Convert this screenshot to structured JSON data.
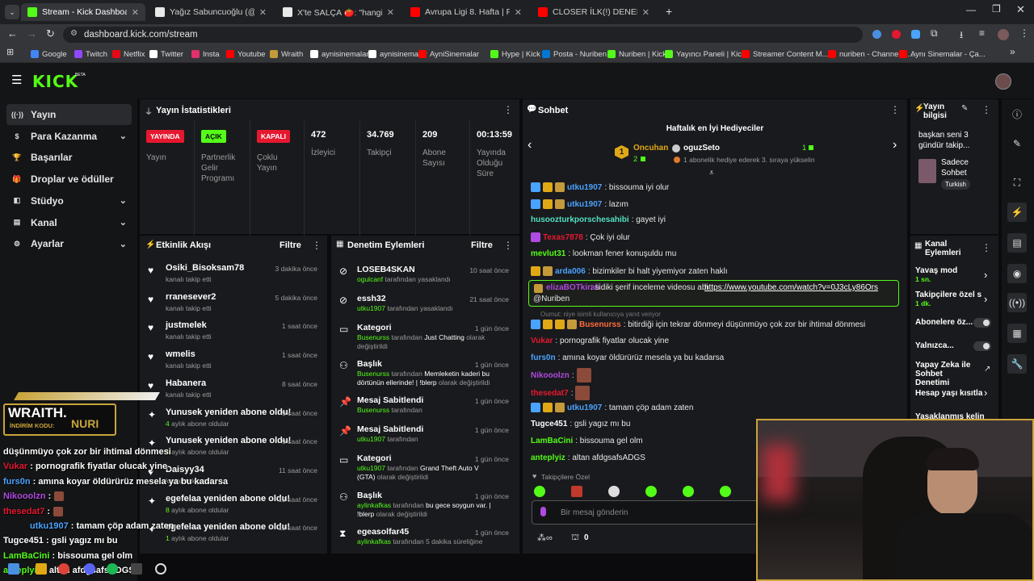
{
  "browser": {
    "tabs": [
      {
        "title": "Stream - Kick Dashboard",
        "color": "#53fc18"
      },
      {
        "title": "Yağız Sabuncuoğlu (@yagosabu",
        "color": "#e8e8e8"
      },
      {
        "title": "X'te SALÇA 🍅: \"hangimiz şamp",
        "color": "#e8e8e8"
      },
      {
        "title": "Avrupa Ligi 8. Hafta | FCSB - Fe",
        "color": "#ff0000"
      },
      {
        "title": "CLOSER İLK(!) DENEMEDE BAŞA",
        "color": "#ff0000"
      }
    ],
    "url": "dashboard.kick.com/stream",
    "bookmarks": [
      "Google",
      "Twitch",
      "Netflix",
      "Twitter",
      "Insta",
      "Youtube",
      "Wraith",
      "aynisinemalar",
      "aynisinemalar",
      "AyniSinemalar",
      "Hype | Kick",
      "Posta - Nuriben",
      "Nuriben | Kick",
      "Yayıncı Paneli | Kick",
      "Streamer Content M...",
      "nuriben - Channel S...",
      "Aynı Sinemalar - Ça..."
    ],
    "bookmark_colors": [
      "#4285f4",
      "#9146ff",
      "#e50914",
      "#ffffff",
      "#e1306c",
      "#ff0000",
      "#c49a3a",
      "#ffffff",
      "#ffffff",
      "#ff0000",
      "#53fc18",
      "#0078d4",
      "#53fc18",
      "#53fc18",
      "#ff0000",
      "#ff0000",
      "#ff0000"
    ]
  },
  "header": {
    "logo": "KICK",
    "beta": "BETA"
  },
  "sidebar": {
    "items": [
      {
        "label": "Yayın",
        "icon": "broadcast-icon"
      },
      {
        "label": "Para Kazanma",
        "icon": "money-icon"
      },
      {
        "label": "Başarılar",
        "icon": "trophy-icon"
      },
      {
        "label": "Droplar ve ödüller",
        "icon": "gift-icon"
      },
      {
        "label": "Stüdyo",
        "icon": "studio-icon"
      },
      {
        "label": "Kanal",
        "icon": "channel-icon"
      },
      {
        "label": "Ayarlar",
        "icon": "gear-icon"
      }
    ]
  },
  "stats": {
    "title": "Yayın İstatistikleri",
    "boxes": [
      {
        "badge": "YAYINDA",
        "badge_color": "#e5182f",
        "label": "Yayın"
      },
      {
        "badge": "AÇIK",
        "badge_color": "#53fc18",
        "label": "Partnerlik Gelir Programı"
      },
      {
        "badge": "KAPALI",
        "badge_color": "#e5182f",
        "label": "Çoklu Yayın"
      },
      {
        "value": "472",
        "label": "İzleyici"
      },
      {
        "value": "34.769",
        "label": "Takipçi"
      },
      {
        "value": "209",
        "label": "Abone Sayısı"
      },
      {
        "value": "00:13:59",
        "label": "Yayında Olduğu Süre"
      }
    ]
  },
  "activity": {
    "title": "Etkinlik Akışı",
    "filter": "Filtre",
    "events": [
      {
        "name": "Osiki_Bisoksam78",
        "sub": "kanalı takip etti",
        "time": "3 dakika önce",
        "kind": "follow"
      },
      {
        "name": "rranesever2",
        "sub": "kanalı takip etti",
        "time": "5 dakika önce",
        "kind": "follow"
      },
      {
        "name": "justmelek",
        "sub": "kanalı takip etti",
        "time": "1 saat önce",
        "kind": "follow"
      },
      {
        "name": "wmelis",
        "sub": "kanalı takip etti",
        "time": "1 saat önce",
        "kind": "follow"
      },
      {
        "name": "Habanera",
        "sub": "kanalı takip etti",
        "time": "8 saat önce",
        "kind": "follow"
      },
      {
        "name": "Yunusek yeniden abone oldu!",
        "sub_num": "4",
        "sub": "aylık abone oldular",
        "time": "9 saat önce",
        "kind": "sub"
      },
      {
        "name": "Yunusek yeniden abone oldu!",
        "sub_num": "1",
        "sub": "aylık abone oldular",
        "time": "9 saat önce",
        "kind": "sub"
      },
      {
        "name": "Daisyy34",
        "sub": "kanalı takip etti",
        "time": "11 saat önce",
        "kind": "follow"
      },
      {
        "name": "egefelaa yeniden abone oldu!",
        "sub_num": "8",
        "sub": "aylık abone oldular",
        "time": "12 saat önce",
        "kind": "sub"
      },
      {
        "name": "egefelaa yeniden abone oldu!",
        "sub_num": "1",
        "sub": "aylık abone oldular",
        "time": "12 saat önce",
        "kind": "sub"
      }
    ]
  },
  "moderation": {
    "title": "Denetim Eylemleri",
    "filter": "Filtre",
    "items": [
      {
        "name": "LOSEB4SKAN",
        "actor": "ogulcanf",
        "text": "tarafından yasaklandı",
        "extra": "",
        "tail": "",
        "time": "10 saat önce",
        "icon": "ban-icon"
      },
      {
        "name": "essh32",
        "actor": "utku1907",
        "text": "tarafından yasaklandı",
        "extra": "",
        "tail": "",
        "time": "21 saat önce",
        "icon": "ban-icon"
      },
      {
        "name": "Kategori",
        "actor": "Busenurss",
        "text": "tarafından",
        "extra": "Just Chatting",
        "tail": "olarak değiştirildi",
        "time": "1 gün önce",
        "icon": "category-icon"
      },
      {
        "name": "Başlık",
        "actor": "Busenurss",
        "text": "tarafından",
        "extra": "Memleketin kaderi bu dörtünün ellerinde! | !blerp",
        "tail": "olarak değiştirildi",
        "time": "1 gün önce",
        "icon": "title-icon"
      },
      {
        "name": "Mesaj Sabitlendi",
        "actor": "Busenurss",
        "text": "tarafından",
        "extra": "",
        "tail": "",
        "time": "1 gün önce",
        "icon": "pin-icon"
      },
      {
        "name": "Mesaj Sabitlendi",
        "actor": "utku1907",
        "text": "tarafından",
        "extra": "",
        "tail": "",
        "time": "1 gün önce",
        "icon": "pin-icon"
      },
      {
        "name": "Kategori",
        "actor": "utku1907",
        "text": "tarafından",
        "extra": "Grand Theft Auto V (GTA)",
        "tail": "olarak değiştirildi",
        "time": "1 gün önce",
        "icon": "category-icon"
      },
      {
        "name": "Başlık",
        "actor": "aylinkafkas",
        "text": "tarafından",
        "extra": "bu gece soygun var. | !blerp",
        "tail": "olarak değiştirildi",
        "time": "1 gün önce",
        "icon": "title-icon"
      },
      {
        "name": "egeasolfar45",
        "actor": "aylinkafkas",
        "text": "tarafından 5 dakika süreliğine",
        "extra": "",
        "tail": "",
        "time": "1 gün önce",
        "icon": "timeout-icon"
      }
    ]
  },
  "chat": {
    "title": "Sohbet",
    "gifters_title": "Haftalık en İyi Hediyeciler",
    "gifter1": {
      "rank": "1",
      "name": "Oncuhan",
      "count": "2"
    },
    "gifter2": {
      "name": "oguzSeto",
      "count": "1",
      "note": "1 abonelik hediye ederek 3. sıraya yükselin"
    },
    "messages": [
      {
        "user": "utku1907",
        "color": "#4aa3ff",
        "text": ": bissouma iyi olur",
        "badges": [
          "#4aa3ff",
          "#e0a815",
          "#c49a3a"
        ]
      },
      {
        "user": "utku1907",
        "color": "#4aa3ff",
        "text": ": lazım",
        "badges": [
          "#4aa3ff",
          "#e0a815",
          "#c49a3a"
        ]
      },
      {
        "user": "husoozturkporschesahibi",
        "color": "#53e0c1",
        "text": ": gayet iyi",
        "badges": []
      },
      {
        "user": "Texas7878",
        "color": "#e5182f",
        "text": ": Çok iyi olur",
        "badges": [
          "#b04ae0"
        ]
      },
      {
        "user": "mevlut31",
        "color": "#53fc18",
        "text": ": lookman fener konuşuldu mu",
        "badges": []
      },
      {
        "user": "arda006",
        "color": "#4aa3ff",
        "text": ": bizimkiler bi halt yiyemiyor zaten haklı",
        "badges": [
          "#e0a815",
          "#c49a3a"
        ]
      },
      {
        "user": "Busenurss",
        "color": "#ff6b3d",
        "text": ": bitirdiği için tekrar dönmeyi düşünmüyo çok zor bir ihtimal dönmesi",
        "badges": [
          "#4aa3ff",
          "#e0a815",
          "#e0a815",
          "#c49a3a"
        ]
      },
      {
        "user": "Vukar",
        "color": "#e5182f",
        "text": ": pornografik fiyatlar olucak yine",
        "badges": []
      },
      {
        "user": "furs0n",
        "color": "#4aa3ff",
        "text": ": amına koyar öldürürüz mesela ya bu kadarsa",
        "badges": []
      },
      {
        "user": "Nikooolzn",
        "color": "#b04ae0",
        "text": ":",
        "badges": [],
        "emote": true
      },
      {
        "user": "thesedat7",
        "color": "#e5182f",
        "text": ":",
        "badges": [],
        "emote": true
      },
      {
        "user": "utku1907",
        "color": "#4aa3ff",
        "text": ": tamam çöp adam zaten",
        "badges": [
          "#4aa3ff",
          "#e0a815",
          "#c49a3a"
        ]
      },
      {
        "user": "Tugce451",
        "color": "#ffffff",
        "text": ": gsli yagız mı bu",
        "badges": []
      },
      {
        "user": "LamBaCini",
        "color": "#53fc18",
        "text": ": bissouma gel olm",
        "badges": []
      },
      {
        "user": "anteplyiz",
        "color": "#53fc18",
        "text": ": altan afdgsafsADGS",
        "badges": []
      }
    ],
    "pinned": {
      "user": "elizaBOTkirali",
      "text": ": sidiki şerif inceleme videosu abi",
      "link": "https://www.youtube.com/watch?v=0J3cLy86Ors",
      "mention": "@Nuriben"
    },
    "reply_note": "Oumut: niye isimli kullanıcıya yanıt veriyor",
    "followers_only": "Takipçilere Özel",
    "input_placeholder": "Bir mesaj gönderin",
    "points": "0"
  },
  "stream_info": {
    "title": "Yayın bilgisi",
    "desc": "başkan seni 3 gündür takip...",
    "category": "Sadece Sohbet",
    "tag": "Turkish"
  },
  "channel_actions": {
    "title": "Kanal Eylemleri",
    "slow_mode": {
      "label": "Yavaş mod",
      "value": "1 sn."
    },
    "followers": {
      "label": "Takipçilere özel s",
      "value": "1 dk."
    },
    "subs_label": "Abonelere öz...",
    "emotes_label": "Yalnızca...",
    "ai_label": "Yapay Zeka ile Sohbet Denetimi",
    "age_label": "Hesap yaşı kısıtla",
    "banned_label": "Yasaklanmış kelin"
  },
  "overlay": {
    "sponsor": "WRAITH.",
    "code_label": "İNDİRİM KODU:",
    "code": "NURI",
    "lines": [
      {
        "text": "düşünmüyo çok zor bir ihtimal dönmesi",
        "color": "#ffffff"
      },
      {
        "user": "Vukar",
        "text": " : pornografik fiyatlar olucak yine",
        "color": "#e5182f"
      },
      {
        "user": "furs0n",
        "text": " : amına koyar öldürürüz mesela ya bu kadarsa",
        "color": "#4aa3ff"
      },
      {
        "user": "Nikooolzn",
        "text": " :",
        "color": "#b04ae0"
      },
      {
        "user": "thesedat7",
        "text": " :",
        "color": "#e5182f"
      },
      {
        "user": "utku1907",
        "text": " : tamam çöp adam zaten",
        "color": "#4aa3ff"
      },
      {
        "user": "Tugce451",
        "text": " : gsli yagız mı bu",
        "color": "#ffffff"
      },
      {
        "user": "LamBaCini",
        "text": " : bissouma gel olm",
        "color": "#53fc18"
      },
      {
        "user": "anteplyiz",
        "text": " : altan afdgsafsADGS",
        "color": "#53fc18"
      }
    ]
  },
  "colors": {
    "accent": "#53fc18",
    "live": "#e5182f",
    "panel": "#191a1d",
    "bg": "#0b0b0d"
  }
}
